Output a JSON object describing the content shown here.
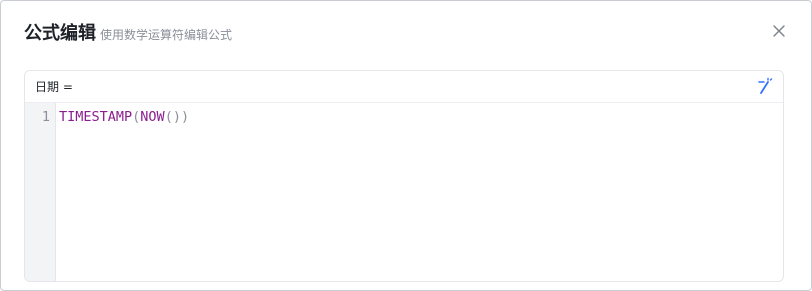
{
  "dialog": {
    "title": "公式编辑",
    "subtitle": "使用数学运算符编辑公式",
    "close_icon": "close-icon"
  },
  "editor": {
    "field_label": "日期 =",
    "format_icon": "magic-wand-icon",
    "line_number": "1",
    "tokens": {
      "fn1": "TIMESTAMP",
      "p1": "(",
      "fn2": "NOW",
      "p2": "()",
      "p3": ")"
    }
  },
  "colors": {
    "function": "#8b1d8f",
    "paren": "#8a8f99",
    "accent": "#3370ff"
  }
}
